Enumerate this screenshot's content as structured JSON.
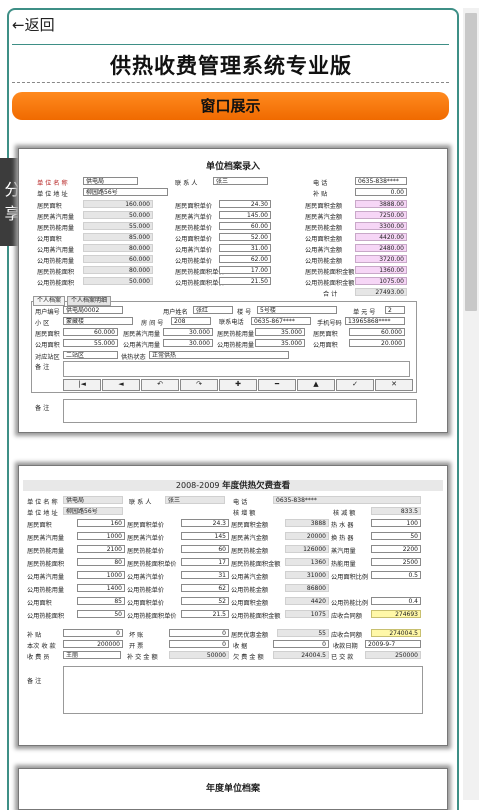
{
  "nav": {
    "back_label": "←返回"
  },
  "page": {
    "title": "供热收费管理系统专业版",
    "section_button": "窗口展示"
  },
  "share": {
    "line1": "分",
    "line2": "享"
  },
  "s1": {
    "title": "单位档案录入",
    "unit_name_label": "单 位 名 称",
    "unit_name": "供电局",
    "contact_label": "联  系  人",
    "contact": "张三",
    "phone_label": "电      话",
    "phone": "0635-838****",
    "unit_addr_label": "单 位 地 址",
    "unit_addr": "柳园路56号",
    "subsidy_label": "补      贴",
    "subsidy": "0.00",
    "rows": [
      {
        "a": "居民面积",
        "av": "160.000",
        "b": "居民面积单价",
        "bv": "24.30",
        "c": "居民面积金额",
        "cv": "3888.00"
      },
      {
        "a": "居民蒸汽用量",
        "av": "50.000",
        "b": "居民蒸汽单价",
        "bv": "145.00",
        "c": "居民蒸汽金额",
        "cv": "7250.00"
      },
      {
        "a": "居民热能用量",
        "av": "55.000",
        "b": "居民热能单价",
        "bv": "60.00",
        "c": "居民热能金额",
        "cv": "3300.00"
      },
      {
        "a": "公用面积",
        "av": "85.000",
        "b": "公用面积单价",
        "bv": "52.00",
        "c": "公用面积金额",
        "cv": "4420.00"
      },
      {
        "a": "公用蒸汽用量",
        "av": "80.000",
        "b": "公用蒸汽单价",
        "bv": "31.00",
        "c": "公用蒸汽金额",
        "cv": "2480.00"
      },
      {
        "a": "公用热能用量",
        "av": "60.000",
        "b": "公用热能单价",
        "bv": "62.00",
        "c": "公用热能金额",
        "cv": "3720.00"
      },
      {
        "a": "居民热能面积",
        "av": "80.000",
        "b": "居民热能面积单价",
        "bv": "17.00",
        "c": "居民热能面积金额",
        "cv": "1360.00"
      },
      {
        "a": "公用热能面积",
        "av": "50.000",
        "b": "公用热能面积单价",
        "bv": "21.50",
        "c": "公用热能面积金额",
        "cv": "1075.00"
      }
    ],
    "total_label": "合   计",
    "total": "27493.00",
    "tab1": "个人档案",
    "tab2": "个人档案明细",
    "user_no_label": "用户编号",
    "user_no": "供电局0002",
    "user_name_label": "用户姓名",
    "user_name": "张红",
    "building_label": "楼  号",
    "building": "5号楼",
    "unit_label": "单 元 号",
    "unit": "2",
    "area_label": "小  区",
    "area": "蒙藏楼",
    "room_label": "房 间 号",
    "room": "208",
    "tel_label": "联系电话",
    "tel": "0635-867****",
    "mobile_label": "手机号码",
    "mobile": "13965868****",
    "p_rows": [
      {
        "a": "居民面积",
        "av": "60.000",
        "b": "居民蒸汽用量",
        "bv": "30.000",
        "c": "居民热能用量",
        "cv": "35.000",
        "d": "居民面积",
        "dv": "60.000"
      },
      {
        "a": "公用面积",
        "av": "55.000",
        "b": "公用蒸汽用量",
        "bv": "30.000",
        "c": "公用热能用量",
        "cv": "35.000",
        "d": "公用面积",
        "dv": "20.000"
      }
    ],
    "station_label": "对应站区",
    "station": "二站区",
    "status_label": "供热状态",
    "status": "正常供热",
    "remark_label": "备  注",
    "nav_buttons": [
      "|◄",
      "◄",
      "↶",
      "↷",
      "✚",
      "━",
      "▲",
      "✓",
      "✕"
    ],
    "remark2_label": "备    注"
  },
  "s2": {
    "year_text": "2008-2009",
    "title": "年度供热欠费查看",
    "unit_name_label": "单 位 名 称",
    "unit_name": "供电局",
    "contact_label": "联  系  人",
    "contact": "张三",
    "phone_label": "电      话",
    "phone": "0635-838****",
    "unit_addr_label": "单 位 地 址",
    "unit_addr": "柳园路56号",
    "tail_label": "核 增 额",
    "reduce_label": "核 减 额",
    "reduce": "833.5",
    "rows": [
      {
        "a": "居民面积",
        "av": "160",
        "b": "居民面积单价",
        "bv": "24.3",
        "c": "居民面积金额",
        "cv": "3888",
        "d": "热 水 器",
        "dv": "100"
      },
      {
        "a": "居民蒸汽用量",
        "av": "1000",
        "b": "居民蒸汽单价",
        "bv": "145",
        "c": "居民蒸汽金额",
        "cv": "20000",
        "d": "换 热 器",
        "dv": "50"
      },
      {
        "a": "居民热能用量",
        "av": "2100",
        "b": "居民热能单价",
        "bv": "60",
        "c": "居民热能金额",
        "cv": "126000",
        "d": "蒸汽用量",
        "dv": "2200"
      },
      {
        "a": "居民热能面积",
        "av": "80",
        "b": "居民热能面积单价",
        "bv": "17",
        "c": "居民热能面积金额",
        "cv": "1360",
        "d": "热能用量",
        "dv": "2500"
      },
      {
        "a": "公用蒸汽用量",
        "av": "1000",
        "b": "公用蒸汽单价",
        "bv": "31",
        "c": "公用蒸汽金额",
        "cv": "31000",
        "d": "公用面积比例",
        "dv": "0.5"
      },
      {
        "a": "公用热能用量",
        "av": "1400",
        "b": "公用热能单价",
        "bv": "62",
        "c": "公用热能金额",
        "cv": "86800",
        "d": "",
        "dv": ""
      },
      {
        "a": "公用面积",
        "av": "85",
        "b": "公用面积单价",
        "bv": "52",
        "c": "公用面积金额",
        "cv": "4420",
        "d": "公用热能比例",
        "dv": "0.4"
      },
      {
        "a": "公用热能面积",
        "av": "50",
        "b": "公用热能面积单价",
        "bv": "21.5",
        "c": "公用热能面积金额",
        "cv": "1075",
        "d": "应收合同额",
        "dv": "274693"
      }
    ],
    "subsidy_label": "补    贴",
    "subsidy": "0",
    "bad_label": "坏    账",
    "bad": "0",
    "res_base_label": "居民优惠金额",
    "res_base": "55",
    "should_label": "应收合同额",
    "should": "274004.5",
    "times_label": "本次 收 款",
    "times": "200000",
    "invoice_label": "开    票",
    "invoice": "0",
    "receipt_label": "收    据",
    "receipt": "0",
    "date_label": "收款日期",
    "date": "2009-9-7",
    "collector_label": "收  费  员",
    "collector": "王丽",
    "paid_label": "补 交 金 额",
    "paid": "50000",
    "owe_label": "欠 费 金 额",
    "owe": "24004.5",
    "already_label": "已 交 款",
    "already": "250000",
    "remark_label": "备    注"
  },
  "s3": {
    "title": "年度单位档案"
  }
}
